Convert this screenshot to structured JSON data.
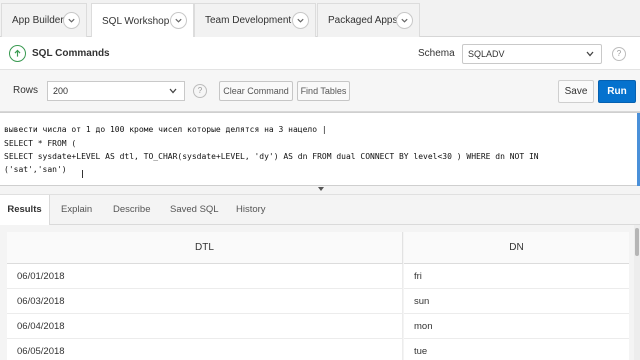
{
  "top_tabs": [
    {
      "label": "App Builder"
    },
    {
      "label": "SQL Workshop"
    },
    {
      "label": "Team Development"
    },
    {
      "label": "Packaged Apps"
    }
  ],
  "header": {
    "title": "SQL Commands",
    "schema_label": "Schema",
    "schema_value": "SQLADV",
    "help": "?"
  },
  "toolbar": {
    "rows_label": "Rows",
    "rows_value": "200",
    "help": "?",
    "clear_label": "Clear Command",
    "find_label": "Find Tables",
    "save_label": "Save",
    "run_label": "Run"
  },
  "editor": {
    "lines": [
      "вывести числа от 1 до 100 кроме чисел которые делятся на 3 нацело |",
      "SELECT * FROM (",
      "SELECT sysdate+LEVEL AS dtl, TO_CHAR(sysdate+LEVEL, 'dy') AS dn FROM dual CONNECT BY level<30 ) WHERE dn NOT IN",
      "('sat','san')"
    ]
  },
  "result_tabs": [
    {
      "label": "Results"
    },
    {
      "label": "Explain"
    },
    {
      "label": "Describe"
    },
    {
      "label": "Saved SQL"
    },
    {
      "label": "History"
    }
  ],
  "table": {
    "columns": [
      "DTL",
      "DN"
    ],
    "rows": [
      [
        "06/01/2018",
        "fri"
      ],
      [
        "06/03/2018",
        "sun"
      ],
      [
        "06/04/2018",
        "mon"
      ],
      [
        "06/05/2018",
        "tue"
      ]
    ]
  },
  "colors": {
    "accent": "#0572ce",
    "success": "#3a9a52"
  }
}
